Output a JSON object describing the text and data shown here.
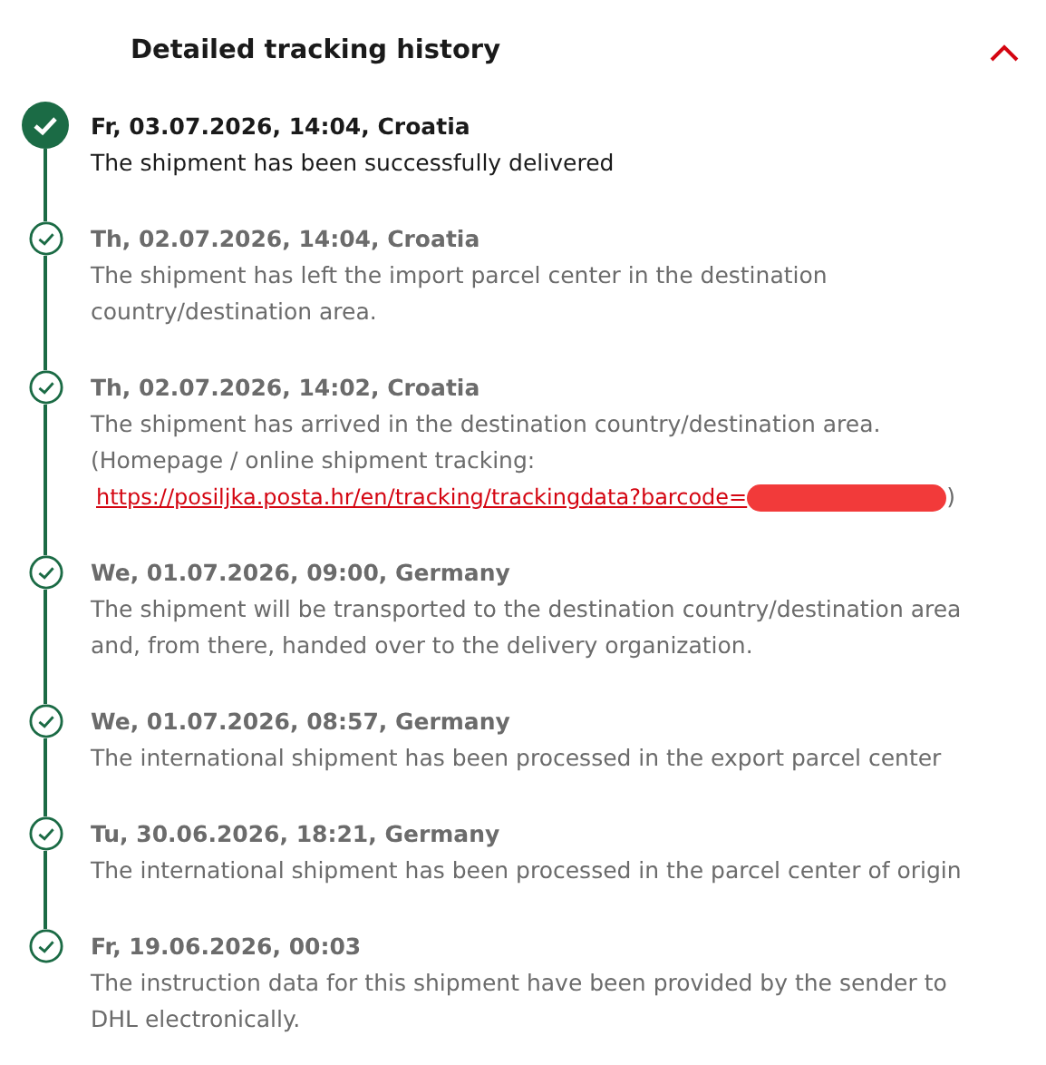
{
  "header": {
    "title": "Detailed tracking history",
    "expanded": true
  },
  "events": [
    {
      "current": true,
      "date": "Fr, 03.07.2026, 14:04, Croatia",
      "text": "The shipment has been successfully delivered"
    },
    {
      "current": false,
      "date": "Th, 02.07.2026, 14:04, Croatia",
      "text": "The shipment has left the import parcel center in the destination country/destination area."
    },
    {
      "current": false,
      "date": "Th, 02.07.2026, 14:02, Croatia",
      "text": "The shipment has arrived in the destination country/destination area.",
      "note": "(Homepage / online shipment tracking:",
      "link": "https://posiljka.posta.hr/en/tracking/trackingdata?barcode=",
      "suffix": ")"
    },
    {
      "current": false,
      "date": "We, 01.07.2026, 09:00, Germany",
      "text": "The shipment will be transported to the destination country/destination area and, from there, handed over to the delivery organization."
    },
    {
      "current": false,
      "date": "We, 01.07.2026, 08:57, Germany",
      "text": "The international shipment has been processed in the export parcel center"
    },
    {
      "current": false,
      "date": "Tu, 30.06.2026, 18:21, Germany",
      "text": "The international shipment has been processed in the parcel center of origin"
    },
    {
      "current": false,
      "date": "Fr, 19.06.2026, 00:03",
      "text": "The instruction data for this shipment have been provided by the sender to DHL electronically."
    }
  ]
}
